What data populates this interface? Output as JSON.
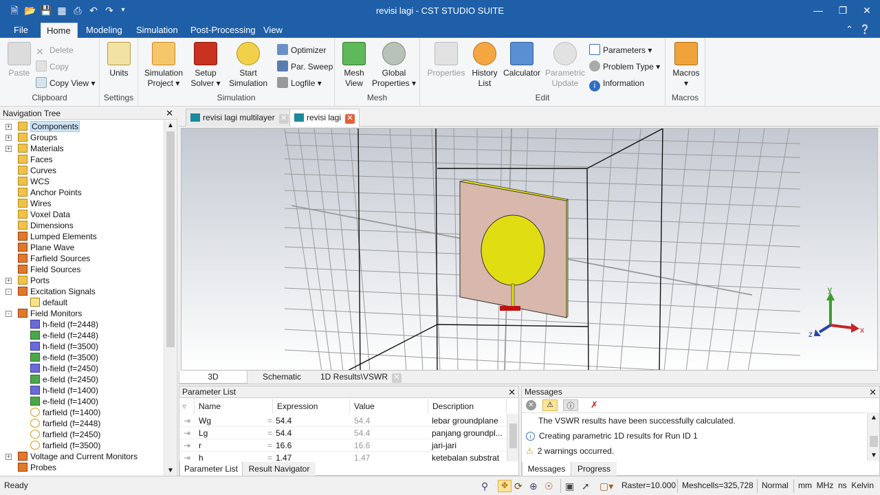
{
  "window": {
    "title": "revisi lagi - CST STUDIO SUITE"
  },
  "ribbon": {
    "tabs": [
      "File",
      "Home",
      "Modeling",
      "Simulation",
      "Post-Processing",
      "View"
    ],
    "active_tab": "Home",
    "clipboard": {
      "group": "Clipboard",
      "paste": "Paste",
      "delete": "Delete",
      "copy": "Copy",
      "copy_view": "Copy View"
    },
    "settings": {
      "group": "Settings",
      "units": "Units"
    },
    "simulation": {
      "group": "Simulation",
      "sim_project": "Simulation Project",
      "setup_solver": "Setup Solver",
      "start_sim": "Start Simulation",
      "optimizer": "Optimizer",
      "par_sweep": "Par. Sweep",
      "logfile": "Logfile"
    },
    "mesh": {
      "group": "Mesh",
      "mesh_view": "Mesh View",
      "global_props": "Global Properties"
    },
    "edit": {
      "group": "Edit",
      "properties": "Properties",
      "history": "History List",
      "calculator": "Calculator",
      "param_update": "Parametric Update",
      "parameters": "Parameters",
      "problem_type": "Problem Type",
      "information": "Information"
    },
    "macros": {
      "group": "Macros",
      "macros": "Macros"
    }
  },
  "nav_tree": {
    "title": "Navigation Tree",
    "items": [
      {
        "label": "Components",
        "expander": "+",
        "selected": true
      },
      {
        "label": "Groups",
        "expander": "+"
      },
      {
        "label": "Materials",
        "expander": "+"
      },
      {
        "label": "Faces"
      },
      {
        "label": "Curves"
      },
      {
        "label": "WCS"
      },
      {
        "label": "Anchor Points"
      },
      {
        "label": "Wires"
      },
      {
        "label": "Voxel Data"
      },
      {
        "label": "Dimensions"
      },
      {
        "label": "Lumped Elements"
      },
      {
        "label": "Plane Wave"
      },
      {
        "label": "Farfield Sources"
      },
      {
        "label": "Field Sources"
      },
      {
        "label": "Ports",
        "expander": "+"
      },
      {
        "label": "Excitation Signals",
        "expander": "-"
      },
      {
        "label": "default",
        "child": true
      },
      {
        "label": "Field Monitors",
        "expander": "-"
      },
      {
        "label": "h-field (f=2448)",
        "child": true,
        "kind": "h"
      },
      {
        "label": "e-field (f=2448)",
        "child": true,
        "kind": "e"
      },
      {
        "label": "h-field (f=3500)",
        "child": true,
        "kind": "h"
      },
      {
        "label": "e-field (f=3500)",
        "child": true,
        "kind": "e"
      },
      {
        "label": "h-field (f=2450)",
        "child": true,
        "kind": "h"
      },
      {
        "label": "e-field (f=2450)",
        "child": true,
        "kind": "e"
      },
      {
        "label": "h-field (f=1400)",
        "child": true,
        "kind": "h"
      },
      {
        "label": "e-field (f=1400)",
        "child": true,
        "kind": "e"
      },
      {
        "label": "farfield (f=1400)",
        "child": true,
        "kind": "ff"
      },
      {
        "label": "farfield (f=2448)",
        "child": true,
        "kind": "ff"
      },
      {
        "label": "farfield (f=2450)",
        "child": true,
        "kind": "ff"
      },
      {
        "label": "farfield (f=3500)",
        "child": true,
        "kind": "ff"
      },
      {
        "label": "Voltage and Current Monitors",
        "expander": "+"
      },
      {
        "label": "Probes"
      }
    ]
  },
  "doc_tabs": [
    "revisi lagi multilayer",
    "revisi lagi"
  ],
  "active_doc": "revisi lagi",
  "view_tabs": [
    "3D",
    "Schematic",
    "1D Results\\VSWR"
  ],
  "axes": {
    "x": "x",
    "y": "y",
    "z": "z"
  },
  "param_list": {
    "title": "Parameter List",
    "columns": [
      "Name",
      "Expression",
      "Value",
      "Description"
    ],
    "rows": [
      {
        "name": "Wg",
        "expr": "54.4",
        "value": "54.4",
        "desc": "lebar groundplane"
      },
      {
        "name": "Lg",
        "expr": "54.4",
        "value": "54.4",
        "desc": "panjang groundpl..."
      },
      {
        "name": "r",
        "expr": "16.6",
        "value": "16.6",
        "desc": "jari-jari"
      },
      {
        "name": "h",
        "expr": "1.47",
        "value": "1.47",
        "desc": "ketebalan substrat"
      }
    ],
    "tabs": [
      "Parameter List",
      "Result Navigator"
    ]
  },
  "messages": {
    "title": "Messages",
    "lines": [
      "The VSWR results have been successfully calculated.",
      "Creating parametric 1D results for Run ID 1",
      "2 warnings occurred."
    ],
    "tabs": [
      "Messages",
      "Progress"
    ]
  },
  "status": {
    "ready": "Ready",
    "raster": "Raster=10.000",
    "meshcells": "Meshcells=325,728",
    "mode": "Normal",
    "units": "mm  MHz  ns  Kelvin"
  },
  "colors": {
    "accent": "#1e5fa8",
    "substrate": "#d8b8ad",
    "patch": "#e1dd13"
  }
}
